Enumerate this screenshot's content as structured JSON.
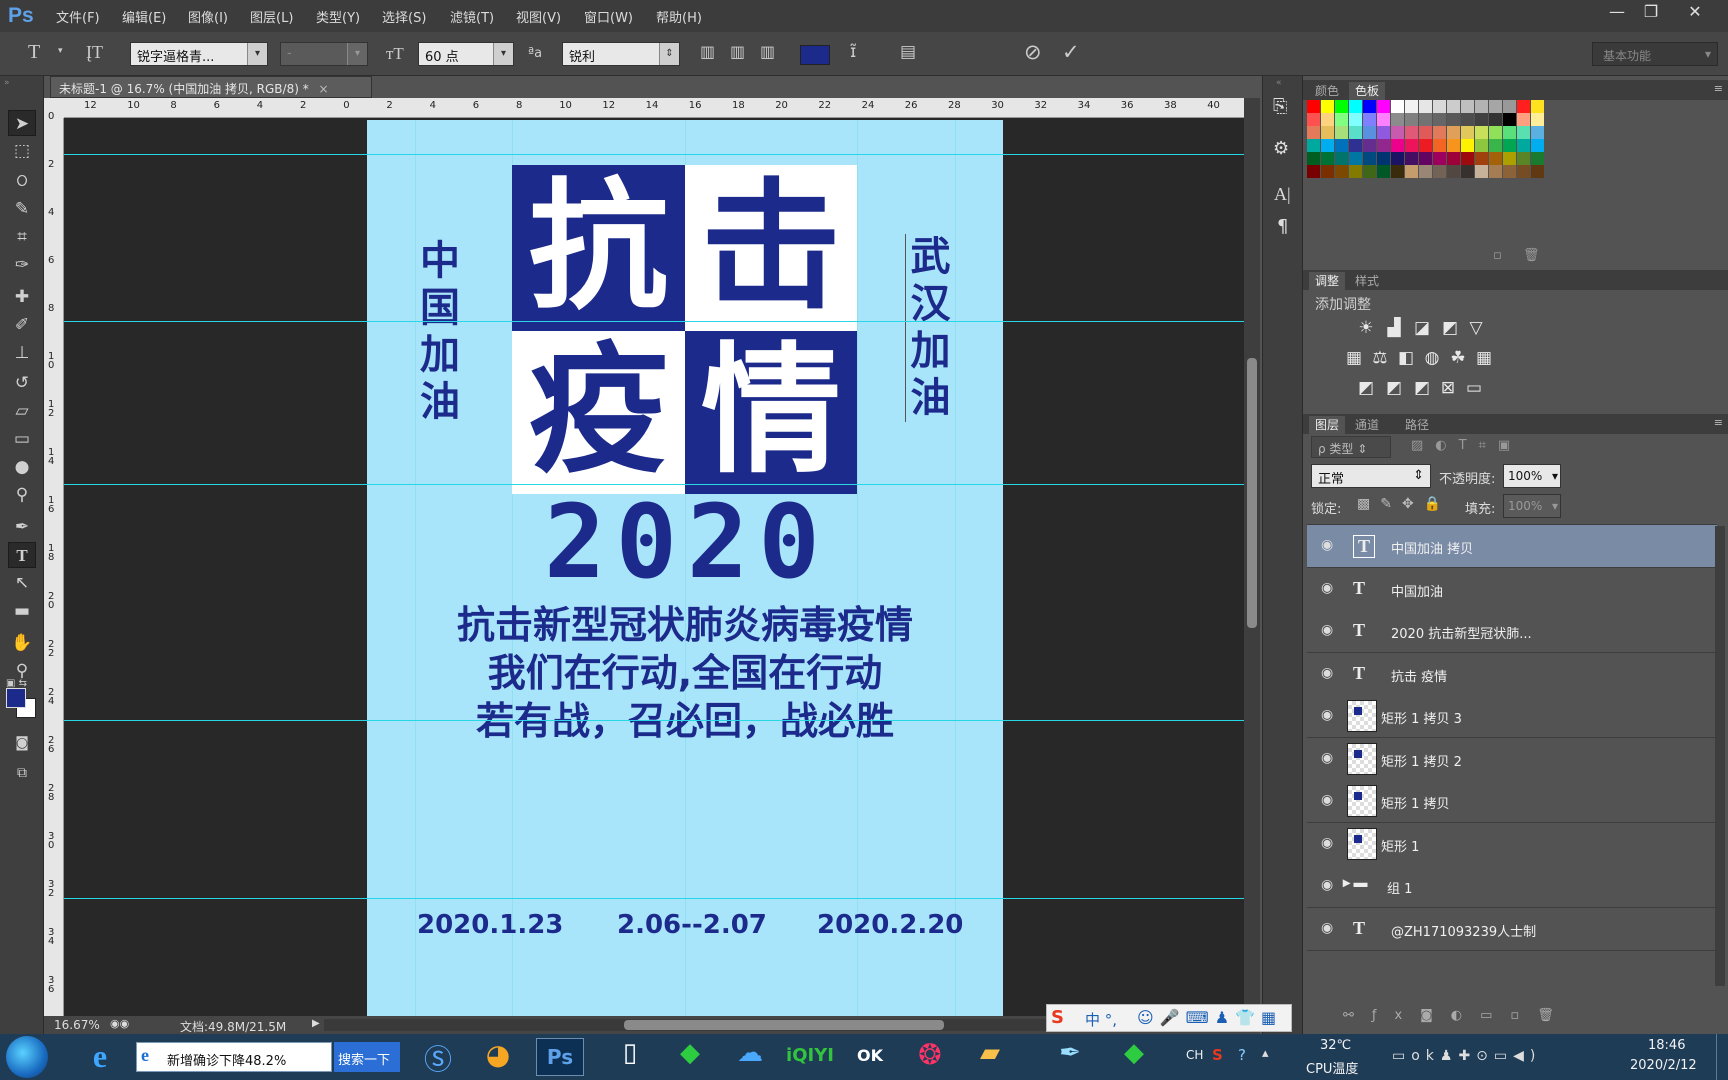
{
  "app": {
    "logo": "Ps"
  },
  "menu": [
    "文件(F)",
    "编辑(E)",
    "图像(I)",
    "图层(L)",
    "类型(Y)",
    "选择(S)",
    "滤镜(T)",
    "视图(V)",
    "窗口(W)",
    "帮助(H)"
  ],
  "window_controls": {
    "minimize": "—",
    "restore": "❐",
    "close": "✕"
  },
  "options": {
    "font_family": "锐字逼格青...",
    "font_style": "-",
    "font_size": "60 点",
    "aa_label": "ªa",
    "antialias": "锐利",
    "text_color": "#1c2a8c",
    "workspace": "基本功能"
  },
  "document": {
    "tab_title": "未标题-1 @ 16.7% (中国加油 拷贝, RGB/8) *",
    "tab_close": "×",
    "ruler_h": [
      "12",
      "10",
      "8",
      "6",
      "4",
      "2",
      "0",
      "2",
      "4",
      "6",
      "8",
      "10",
      "12",
      "14",
      "16",
      "18",
      "20",
      "22",
      "24",
      "26",
      "28",
      "30",
      "32",
      "34",
      "36",
      "38",
      "40"
    ],
    "ruler_v": [
      "0",
      "2",
      "4",
      "6",
      "8",
      "1 0",
      "1 2",
      "1 4",
      "1 6",
      "1 8",
      "2 0",
      "2 2",
      "2 4",
      "2 6",
      "2 8",
      "3 0",
      "3 2",
      "3 4",
      "3 6"
    ]
  },
  "poster": {
    "bg": "#a9e5fa",
    "dark": "#1c2a8c",
    "light": "#ffffff",
    "big_chars": [
      "抗",
      "击",
      "疫",
      "情"
    ],
    "left_vertical": [
      "中",
      "国",
      "加",
      "油"
    ],
    "right_vertical": [
      "武",
      "汉",
      "加",
      "油"
    ],
    "year": "2020",
    "line1": "抗击新型冠状肺炎病毒疫情",
    "line2": "我们在行动,全国在行动",
    "line3": "若有战，召必回，战必胜",
    "date1": "2020.1.23",
    "date2": "2.06--2.07",
    "date3": "2020.2.20"
  },
  "status": {
    "zoom": "16.67%",
    "doc": "文档:49.8M/21.5M"
  },
  "right_panel": {
    "tabs_color": [
      "颜色",
      "色板"
    ],
    "tabs_adjust": [
      "调整",
      "样式"
    ],
    "add_adjust": "添加调整",
    "tabs_layers": [
      "图层",
      "通道",
      "路径"
    ],
    "filter_kind": "ρ 类型",
    "blend_mode": "正常",
    "opacity_label": "不透明度:",
    "opacity_value": "100%",
    "lock_label": "锁定:",
    "fill_label": "填充:",
    "fill_value": "100%",
    "layers": [
      {
        "name": "中国加油 拷贝",
        "type": "text",
        "selected": true
      },
      {
        "name": "中国加油",
        "type": "text",
        "selected": false
      },
      {
        "name": "2020 抗击新型冠状肺...",
        "type": "text",
        "selected": false
      },
      {
        "name": "抗击 疫情",
        "type": "text",
        "selected": false
      },
      {
        "name": "矩形 1 拷贝 3",
        "type": "shape",
        "selected": false
      },
      {
        "name": "矩形 1 拷贝 2",
        "type": "shape",
        "selected": false
      },
      {
        "name": "矩形 1 拷贝",
        "type": "shape",
        "selected": false
      },
      {
        "name": "矩形 1",
        "type": "shape",
        "selected": false
      },
      {
        "name": "组 1",
        "type": "group",
        "selected": false
      },
      {
        "name": "@ZH171093239人士制",
        "type": "text",
        "selected": false
      }
    ]
  },
  "taskbar": {
    "ie_tab": "新增确诊下降48.2%",
    "search_btn": "搜索一下",
    "ime": "中 °,",
    "lang": "CH",
    "temp": "32℃",
    "temp_label": "CPU温度",
    "time": "18:46",
    "date": "2020/2/12"
  }
}
